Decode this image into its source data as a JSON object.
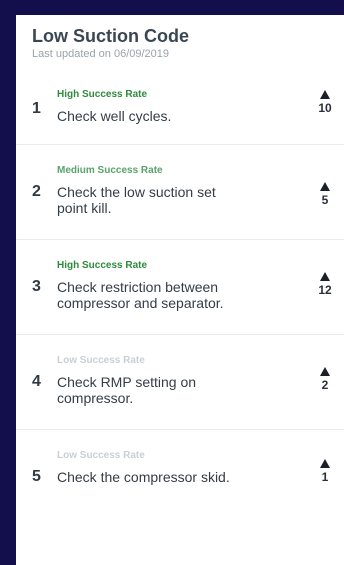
{
  "header": {
    "title": "Low Suction Code",
    "subtitle": "Last updated on 06/09/2019"
  },
  "items": [
    {
      "rank": "1",
      "rate": "High Success Rate",
      "rate_color": "#2e8b3d",
      "text": "Check well cycles.",
      "votes": "10",
      "icon": "upvote-arrow-icon"
    },
    {
      "rank": "2",
      "rate": "Medium Success Rate",
      "rate_color": "#5aa16c",
      "text": "Check the low suction set point kill.",
      "votes": "5",
      "icon": "upvote-arrow-icon"
    },
    {
      "rank": "3",
      "rate": "High Success Rate",
      "rate_color": "#2e8b3d",
      "text": "Check restriction between compressor and separator.",
      "votes": "12",
      "icon": "upvote-arrow-icon"
    },
    {
      "rank": "4",
      "rate": "Low Success Rate",
      "rate_color": "#c8d0d6",
      "text": "Check RMP setting on compressor.",
      "votes": "2",
      "icon": "upvote-arrow-icon"
    },
    {
      "rank": "5",
      "rate": "Low Success Rate",
      "rate_color": "#c8d0d6",
      "text": "Check the compressor skid.",
      "votes": "1",
      "icon": "upvote-arrow-icon"
    }
  ]
}
